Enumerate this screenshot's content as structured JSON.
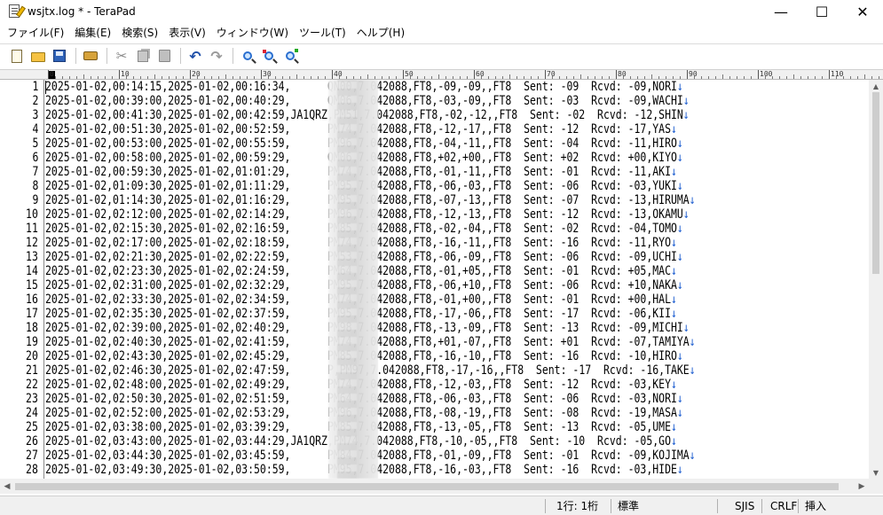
{
  "window": {
    "title": "wsjtx.log * - TeraPad",
    "minimize": "—",
    "maximize": "☐",
    "close": "✕"
  },
  "menu": [
    "ファイル(F)",
    "編集(E)",
    "検索(S)",
    "表示(V)",
    "ウィンドウ(W)",
    "ツール(T)",
    "ヘルプ(H)"
  ],
  "ruler": [
    "0",
    "10",
    "20",
    "30",
    "40",
    "50",
    "60",
    "70",
    "80",
    "90",
    "100",
    "110"
  ],
  "eol_mark": "↓",
  "lines": [
    {
      "n": "1",
      "left": "2025-01-02,00:14:15,2025-01-02,00:16:34,",
      "right": "QN00,7.042088,FT8,-09,-09,,FT8  Sent: -09  Rcvd: -09,NORI",
      "eol": true
    },
    {
      "n": "2",
      "left": "2025-01-02,00:39:00,2025-01-02,00:40:29,",
      "right": "QM06,7.042088,FT8,-03,-09,,FT8  Sent: -03  Rcvd: -09,WACHI",
      "eol": true
    },
    {
      "n": "3",
      "left": "2025-01-02,00:41:30,2025-01-02,00:42:59,JA1QRZ,",
      "right": "PM51,7.042088,FT8,-02,-12,,FT8  Sent: -02  Rcvd: -12,SHIN",
      "eol": true
    },
    {
      "n": "4",
      "left": "2025-01-02,00:51:30,2025-01-02,00:52:59,",
      "right": "PM74,7.042088,FT8,-12,-17,,FT8  Sent: -12  Rcvd: -17,YAS",
      "eol": true
    },
    {
      "n": "5",
      "left": "2025-01-02,00:53:00,2025-01-02,00:55:59,",
      "right": "PM96,7.042088,FT8,-04,-11,,FT8  Sent: -04  Rcvd: -11,HIRO",
      "eol": true
    },
    {
      "n": "6",
      "left": "2025-01-02,00:58:00,2025-01-02,00:59:29,",
      "right": "QM06,7.042088,FT8,+02,+00,,FT8  Sent: +02  Rcvd: +00,KIYO",
      "eol": true
    },
    {
      "n": "7",
      "left": "2025-01-02,00:59:30,2025-01-02,01:01:29,",
      "right": "PM74,7.042088,FT8,-01,-11,,FT8  Sent: -01  Rcvd: -11,AKI",
      "eol": true
    },
    {
      "n": "8",
      "left": "2025-01-02,01:09:30,2025-01-02,01:11:29,",
      "right": "PM95,7.042088,FT8,-06,-03,,FT8  Sent: -06  Rcvd: -03,YUKI",
      "eol": true
    },
    {
      "n": "9",
      "left": "2025-01-02,01:14:30,2025-01-02,01:16:29,",
      "right": "PM95,7.042088,FT8,-07,-13,,FT8  Sent: -07  Rcvd: -13,HIRUMA",
      "eol": true
    },
    {
      "n": "10",
      "left": "2025-01-02,02:12:00,2025-01-02,02:14:29,",
      "right": "PM96,7.042088,FT8,-12,-13,,FT8  Sent: -12  Rcvd: -13,OKAMU",
      "eol": true
    },
    {
      "n": "11",
      "left": "2025-01-02,02:15:30,2025-01-02,02:16:59,",
      "right": "PM85,7.042088,FT8,-02,-04,,FT8  Sent: -02  Rcvd: -04,TOMO",
      "eol": true
    },
    {
      "n": "12",
      "left": "2025-01-02,02:17:00,2025-01-02,02:18:59,",
      "right": "PM74,7.042088,FT8,-16,-11,,FT8  Sent: -16  Rcvd: -11,RYO",
      "eol": true
    },
    {
      "n": "13",
      "left": "2025-01-02,02:21:30,2025-01-02,02:22:59,",
      "right": "PM53,7.042088,FT8,-06,-09,,FT8  Sent: -06  Rcvd: -09,UCHI",
      "eol": true
    },
    {
      "n": "14",
      "left": "2025-01-02,02:23:30,2025-01-02,02:24:59,",
      "right": "PM64,7.042088,FT8,-01,+05,,FT8  Sent: -01  Rcvd: +05,MAC",
      "eol": true
    },
    {
      "n": "15",
      "left": "2025-01-02,02:31:00,2025-01-02,02:32:29,",
      "right": "PM95,7.042088,FT8,-06,+10,,FT8  Sent: -06  Rcvd: +10,NAKA",
      "eol": true
    },
    {
      "n": "16",
      "left": "2025-01-02,02:33:30,2025-01-02,02:34:59,",
      "right": "PM74,7.042088,FT8,-01,+00,,FT8  Sent: -01  Rcvd: +00,HAL",
      "eol": true
    },
    {
      "n": "17",
      "left": "2025-01-02,02:35:30,2025-01-02,02:37:59,",
      "right": "PM95,7.042088,FT8,-17,-06,,FT8  Sent: -17  Rcvd: -06,KII",
      "eol": true
    },
    {
      "n": "18",
      "left": "2025-01-02,02:39:00,2025-01-02,02:40:29,",
      "right": "PM98,7.042088,FT8,-13,-09,,FT8  Sent: -13  Rcvd: -09,MICHI",
      "eol": true
    },
    {
      "n": "19",
      "left": "2025-01-02,02:40:30,2025-01-02,02:41:59,",
      "right": "PM74,7.042088,FT8,+01,-07,,FT8  Sent: +01  Rcvd: -07,TAMIYA",
      "eol": true
    },
    {
      "n": "20",
      "left": "2025-01-02,02:43:30,2025-01-02,02:45:29,",
      "right": "PM85,7.042088,FT8,-16,-10,,FT8  Sent: -16  Rcvd: -10,HIRO",
      "eol": true
    },
    {
      "n": "21",
      "left": "2025-01-02,02:46:30,2025-01-02,02:47:59,",
      "right": "P,PM97,7.042088,FT8,-17,-16,,FT8  Sent: -17  Rcvd: -16,TAKE",
      "eol": true
    },
    {
      "n": "22",
      "left": "2025-01-02,02:48:00,2025-01-02,02:49:29,",
      "right": "PM74,7.042088,FT8,-12,-03,,FT8  Sent: -12  Rcvd: -03,KEY",
      "eol": true
    },
    {
      "n": "23",
      "left": "2025-01-02,02:50:30,2025-01-02,02:51:59,",
      "right": "PM64,7.042088,FT8,-06,-03,,FT8  Sent: -06  Rcvd: -03,NORI",
      "eol": true
    },
    {
      "n": "24",
      "left": "2025-01-02,02:52:00,2025-01-02,02:53:29,",
      "right": "PM96,7.042088,FT8,-08,-19,,FT8  Sent: -08  Rcvd: -19,MASA",
      "eol": true
    },
    {
      "n": "25",
      "left": "2025-01-02,03:38:00,2025-01-02,03:39:29,",
      "right": "PM85,7.042088,FT8,-13,-05,,FT8  Sent: -13  Rcvd: -05,UME",
      "eol": true
    },
    {
      "n": "26",
      "left": "2025-01-02,03:43:00,2025-01-02,03:44:29,JA1QRZ,",
      "right": "PM74,7.042088,FT8,-10,-05,,FT8  Sent: -10  Rcvd: -05,GO",
      "eol": true
    },
    {
      "n": "27",
      "left": "2025-01-02,03:44:30,2025-01-02,03:45:59,",
      "right": "PM84,7.042088,FT8,-01,-09,,FT8  Sent: -01  Rcvd: -09,KOJIMA",
      "eol": true
    },
    {
      "n": "28",
      "left": "2025-01-02,03:49:30,2025-01-02,03:50:59,",
      "right": "PM95,7.042088,FT8,-16,-03,,FT8  Sent: -16  Rcvd: -03,HIDE",
      "eol": true
    }
  ],
  "status": {
    "position": "1行:  1桁",
    "mode": "標準",
    "encoding": "SJIS",
    "line_ending": "CRLF",
    "insert": "挿入"
  }
}
